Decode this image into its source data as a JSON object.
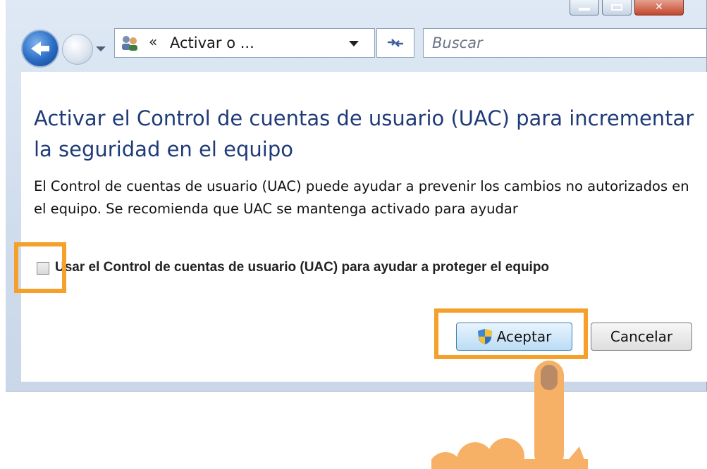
{
  "window": {
    "address_path": "Activar o ...",
    "address_chevron": "«",
    "search_placeholder": "Buscar",
    "refresh_glyph": "⁴ʸ"
  },
  "dialog": {
    "title": "Activar el Control de cuentas de usuario (UAC) para incrementar la seguridad en el equipo",
    "description": "El Control de cuentas de usuario (UAC) puede ayudar a prevenir los cambios no autorizados en el equipo. Se recomienda que UAC se mantenga activado para ayudar",
    "checkbox_label": "Usar el Control de cuentas de usuario (UAC) para ayudar a proteger el equipo",
    "checkbox_checked": false,
    "accept_label": "Aceptar",
    "cancel_label": "Cancelar"
  },
  "colors": {
    "title": "#1f3b78",
    "highlight": "#f5a02a",
    "hand": "#f7b167"
  },
  "icons": {
    "back": "back-arrow-icon",
    "forward": "forward-arrow-icon",
    "address": "users-icon",
    "refresh": "refresh-icon",
    "accept": "uac-shield-icon",
    "pointer": "pointing-hand-icon"
  }
}
